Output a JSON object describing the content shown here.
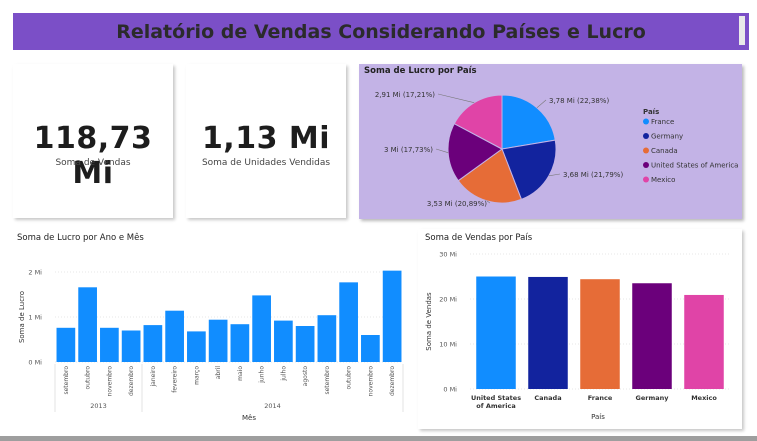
{
  "header": {
    "title": "Relatório de Vendas Considerando Países e Lucro"
  },
  "kpis": [
    {
      "value": "118,73 Mi",
      "label": "Soma de Vendas"
    },
    {
      "value": "1,13 Mi",
      "label": "Soma de Unidades Vendidas"
    }
  ],
  "pie": {
    "title": "Soma de Lucro por País",
    "legend_title": "País",
    "slices": [
      {
        "name": "France",
        "label": "3,78 Mi (22,38%)",
        "value": 3.78,
        "percent": 22.38,
        "color": "#118dff"
      },
      {
        "name": "Germany",
        "label": "3,68 Mi (21,79%)",
        "value": 3.68,
        "percent": 21.79,
        "color": "#12239e"
      },
      {
        "name": "Canada",
        "label": "3,53 Mi (20,89%)",
        "value": 3.53,
        "percent": 20.89,
        "color": "#e66c37"
      },
      {
        "name": "United States of America",
        "label": "3 Mi (17,73%)",
        "value": 3.0,
        "percent": 17.73,
        "color": "#6b007b"
      },
      {
        "name": "Mexico",
        "label": "2,91 Mi (17,21%)",
        "value": 2.91,
        "percent": 17.21,
        "color": "#e044a7"
      }
    ]
  },
  "profit_chart": {
    "title": "Soma de Lucro por Ano e Mês",
    "ylabel": "Soma de Lucro",
    "xlabel": "Mês",
    "yticks": [
      "0 Mi",
      "1 Mi",
      "2 Mi"
    ],
    "ylim": [
      0,
      2
    ],
    "color": "#118dff",
    "years": [
      {
        "label": "2013",
        "months": [
          "setembro",
          "outubro",
          "novembro",
          "dezembro"
        ],
        "values": [
          0.76,
          1.66,
          0.76,
          0.7
        ]
      },
      {
        "label": "2014",
        "months": [
          "janeiro",
          "fevereiro",
          "março",
          "abril",
          "maio",
          "junho",
          "julho",
          "agosto",
          "setembro",
          "outubro",
          "novembro",
          "dezembro"
        ],
        "values": [
          0.82,
          1.14,
          0.68,
          0.94,
          0.84,
          1.48,
          0.92,
          0.8,
          1.04,
          1.77,
          0.6,
          2.03
        ]
      }
    ]
  },
  "sales_chart": {
    "title": "Soma de Vendas por País",
    "ylabel": "Soma de Vendas",
    "xlabel": "País",
    "yticks": [
      "0 Mi",
      "10 Mi",
      "20 Mi",
      "30 Mi"
    ],
    "ylim": [
      0,
      30
    ],
    "bars": [
      {
        "category": "United States of America",
        "value": 25.0,
        "color": "#118dff"
      },
      {
        "category": "Canada",
        "value": 24.9,
        "color": "#12239e"
      },
      {
        "category": "France",
        "value": 24.4,
        "color": "#e66c37"
      },
      {
        "category": "Germany",
        "value": 23.5,
        "color": "#6b007b"
      },
      {
        "category": "Mexico",
        "value": 20.9,
        "color": "#e044a7"
      }
    ]
  },
  "chart_data": [
    {
      "type": "pie",
      "title": "Soma de Lucro por País",
      "labels": [
        "France",
        "Germany",
        "Canada",
        "United States of America",
        "Mexico"
      ],
      "values": [
        3.78,
        3.68,
        3.53,
        3.0,
        2.91
      ],
      "percents": [
        22.38,
        21.79,
        20.89,
        17.73,
        17.21
      ],
      "legend": "right"
    },
    {
      "type": "bar",
      "title": "Soma de Lucro por Ano e Mês",
      "xlabel": "Mês",
      "ylabel": "Soma de Lucro",
      "categories": [
        "2013 setembro",
        "2013 outubro",
        "2013 novembro",
        "2013 dezembro",
        "2014 janeiro",
        "2014 fevereiro",
        "2014 março",
        "2014 abril",
        "2014 maio",
        "2014 junho",
        "2014 julho",
        "2014 agosto",
        "2014 setembro",
        "2014 outubro",
        "2014 novembro",
        "2014 dezembro"
      ],
      "values": [
        0.76,
        1.66,
        0.76,
        0.7,
        0.82,
        1.14,
        0.68,
        0.94,
        0.84,
        1.48,
        0.92,
        0.8,
        1.04,
        1.77,
        0.6,
        2.03
      ],
      "ylim": [
        0,
        2
      ],
      "grid": true
    },
    {
      "type": "bar",
      "title": "Soma de Vendas por País",
      "xlabel": "País",
      "ylabel": "Soma de Vendas",
      "categories": [
        "United States of America",
        "Canada",
        "France",
        "Germany",
        "Mexico"
      ],
      "values": [
        25.0,
        24.9,
        24.4,
        23.5,
        20.9
      ],
      "ylim": [
        0,
        30
      ],
      "grid": true
    }
  ]
}
